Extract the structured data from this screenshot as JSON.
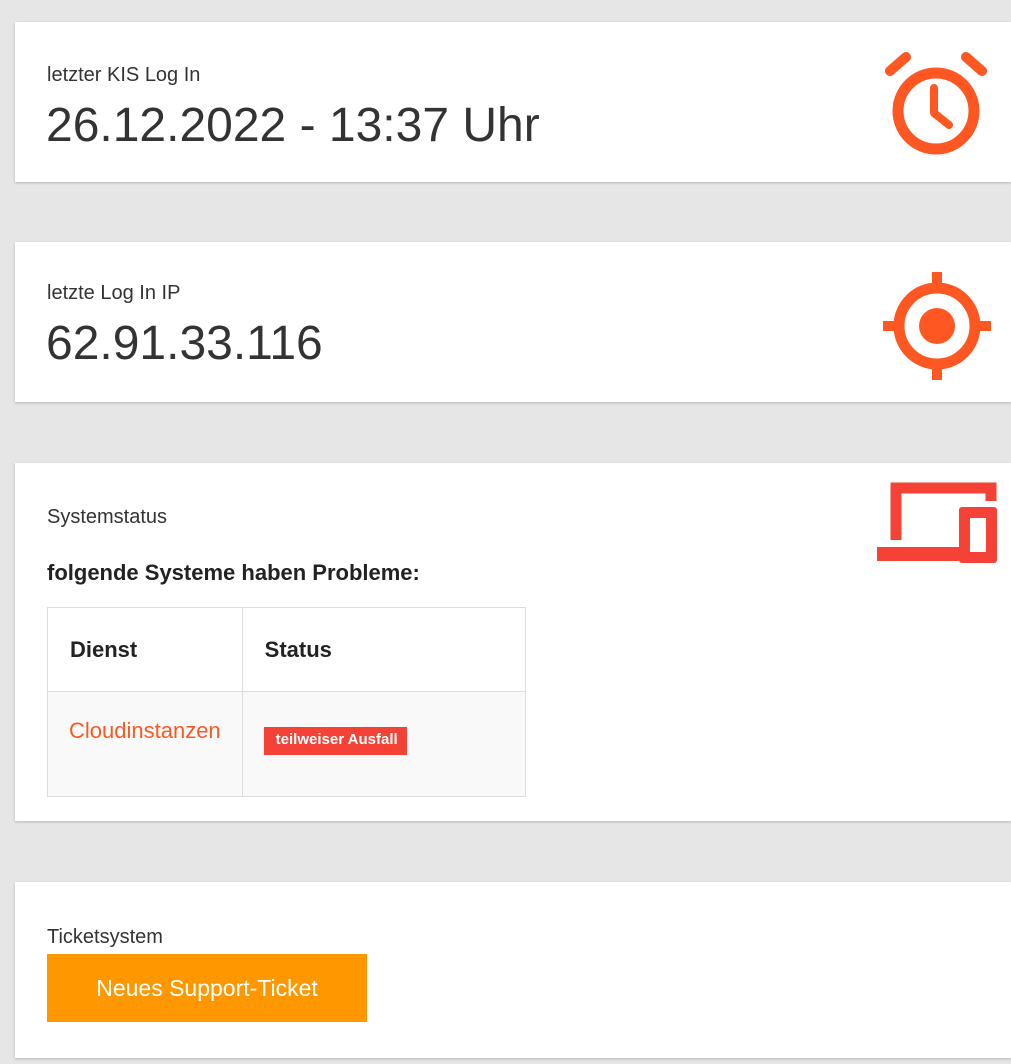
{
  "colors": {
    "accent_orange": "#ff5722",
    "status_red": "#f44336",
    "button_orange": "#ff9800",
    "background": "#e6e6e6"
  },
  "last_login": {
    "label": "letzter KIS Log In",
    "value": "26.12.2022 - 13:37 Uhr",
    "icon": "alarm-clock-icon"
  },
  "last_ip": {
    "label": "letzte Log In IP",
    "value": "62.91.33.116",
    "icon": "gps-crosshair-icon"
  },
  "system_status": {
    "label": "Systemstatus",
    "subheading": "folgende Systeme haben Probleme:",
    "icon": "devices-icon",
    "table": {
      "headers": [
        "Dienst",
        "Status"
      ],
      "rows": [
        {
          "service": "Cloudinstanzen",
          "status": "teilweiser Ausfall"
        }
      ]
    }
  },
  "ticket": {
    "label": "Ticketsystem",
    "button_label": "Neues Support-Ticket"
  }
}
